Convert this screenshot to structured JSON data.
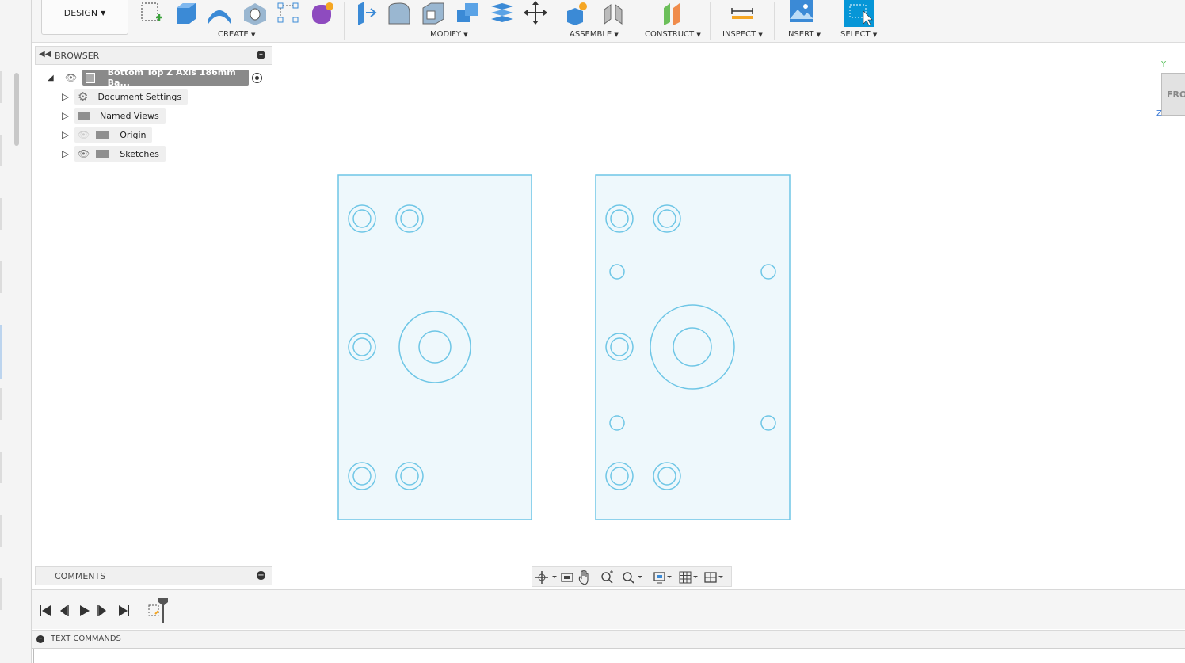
{
  "toolbar": {
    "workspace_label": "DESIGN",
    "groups": [
      {
        "label": "CREATE"
      },
      {
        "label": "MODIFY"
      },
      {
        "label": "ASSEMBLE"
      },
      {
        "label": "CONSTRUCT"
      },
      {
        "label": "INSPECT"
      },
      {
        "label": "INSERT"
      },
      {
        "label": "SELECT"
      }
    ]
  },
  "browser": {
    "title": "BROWSER",
    "root": {
      "label": "Bottom Top Z Axis 186mm Ba..."
    },
    "items": [
      {
        "label": "Document Settings",
        "icon": "gear-icon"
      },
      {
        "label": "Named Views",
        "icon": "folder-icon"
      },
      {
        "label": "Origin",
        "icon": "folder-icon",
        "visibility": "hidden"
      },
      {
        "label": "Sketches",
        "icon": "folder-icon",
        "visibility": "visible"
      }
    ]
  },
  "comments": {
    "title": "COMMENTS"
  },
  "text_commands": {
    "title": "TEXT COMMANDS"
  },
  "viewcube": {
    "face_label": "FRO",
    "axis_y": "Y",
    "axis_z": "Z"
  },
  "colors": {
    "sketch_line": "#6ec6e6",
    "sketch_fill": "#eef8fc",
    "select_accent": "#0696d7",
    "toolbar_bg": "#f5f5f5"
  }
}
